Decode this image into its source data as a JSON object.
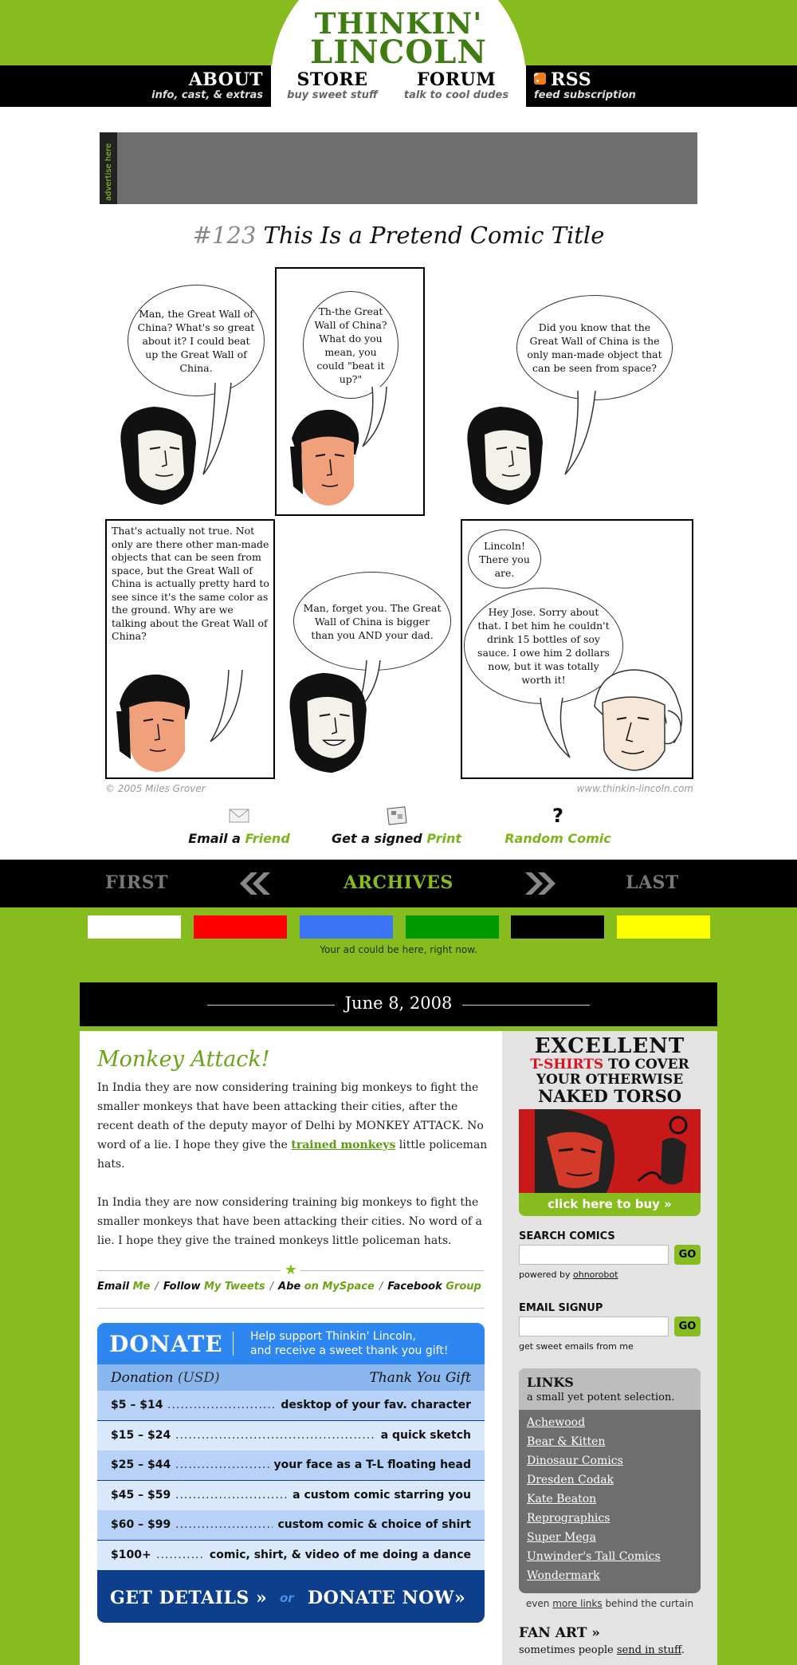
{
  "header": {
    "logo_line1": "THINKIN'",
    "logo_line2": "LINCOLN",
    "nav": [
      {
        "title": "ABOUT",
        "sub": "info, cast, & extras"
      },
      {
        "title": "STORE",
        "sub": "buy sweet stuff"
      },
      {
        "title": "FORUM",
        "sub": "talk to cool dudes"
      },
      {
        "title": "RSS",
        "sub": "feed subscription"
      }
    ]
  },
  "ad": {
    "side_label": "advertise here"
  },
  "comic": {
    "number": "#123",
    "title": "This Is a Pretend Comic Title",
    "bubbles": [
      "Man, the Great Wall of China? What's so great about it? I could beat up the Great Wall of China.",
      "Th-the Great Wall of China? What do you mean, you could \"beat it up?\"",
      "Did you know that the Great Wall of China is the only man-made object that can be seen from space?",
      "That's actually not true. Not only are there other man-made objects that can be seen from space, but the Great Wall of China is actually pretty hard to see since it's the same color as the ground. Why are we talking about the Great Wall of China?",
      "Man, forget you. The Great Wall of China is bigger than you AND your dad.",
      "Lincoln! There you are.",
      "Hey Jose. Sorry about that. I bet him he couldn't drink 15 bottles of soy sauce. I owe him 2 dollars now, but it was totally worth it!"
    ],
    "copyright": "© 2005 Miles Grover",
    "site": "www.thinkin-lincoln.com"
  },
  "share": {
    "email_a": "Email a",
    "email_b": "Friend",
    "print_a": "Get a signed",
    "print_b": "Print",
    "random": "Random Comic"
  },
  "comic_nav": {
    "first": "FIRST",
    "archives": "ARCHIVES",
    "last": "LAST"
  },
  "swatches": {
    "colors": [
      "#ffffff",
      "#ff0000",
      "#3b74f5",
      "#009900",
      "#000000",
      "#ffff00"
    ],
    "caption": "Your ad could be here, right now."
  },
  "post": {
    "date": "June 8, 2008",
    "title": "Monkey Attack!",
    "p1_a": "In India they are now considering training big monkeys to fight the smaller monkeys that have been attacking their cities, after the recent death of the deputy mayor of Delhi by MONKEY ATTACK. No word of a lie. I hope they give the",
    "p1_link": "trained monkeys",
    "p1_b": "little policeman hats.",
    "p2": "In India they are now considering training big monkeys to fight the smaller monkeys that have been attacking their cities. No word of a lie. I hope they give the trained monkeys little policeman hats.",
    "social": [
      {
        "a": "Email",
        "b": "Me"
      },
      {
        "a": "Follow",
        "b": "My Tweets"
      },
      {
        "a": "Abe",
        "b": "on MySpace"
      },
      {
        "a": "Facebook",
        "b": "Group"
      }
    ]
  },
  "donate": {
    "title": "DONATE",
    "sub1": "Help support Thinkin' Lincoln,",
    "sub2": "and receive a sweet thank you gift!",
    "col_left": "Donation",
    "col_left_unit": "(USD)",
    "col_right": "Thank You Gift",
    "rows": [
      {
        "amount": "$5 – $14",
        "gift": "desktop of your fav. character"
      },
      {
        "amount": "$15 – $24",
        "gift": "a quick sketch"
      },
      {
        "amount": "$25 – $44",
        "gift": "your face as a T-L floating head"
      },
      {
        "amount": "$45 – $59",
        "gift": "a custom comic starring you"
      },
      {
        "amount": "$60 – $99",
        "gift": "custom comic & choice of shirt"
      },
      {
        "amount": "$100+",
        "gift": "comic, shirt, & video of me doing a dance"
      }
    ],
    "details": "GET DETAILS »",
    "or": "or",
    "now": "DONATE NOW»"
  },
  "sidebar": {
    "tshirt_h1": "EXCELLENT",
    "tshirt_red": "T-SHIRTS",
    "tshirt_h2a": "TO COVER",
    "tshirt_h2b": "YOUR OTHERWISE",
    "tshirt_h2c": "NAKED TORSO",
    "tshirt_btn": "click here to buy »",
    "search_label": "SEARCH COMICS",
    "search_placeholder": "",
    "search_go": "GO",
    "powered": "powered by",
    "powered_link": "ohnorobot",
    "email_label": "EMAIL SIGNUP",
    "email_placeholder": "",
    "email_go": "GO",
    "email_note": "get sweet emails from me",
    "links_title": "LINKS",
    "links_sub": "a small yet potent selection.",
    "links": [
      "Achewood",
      "Bear & Kitten",
      "Dinosaur Comics",
      "Dresden Codak",
      "Kate Beaton",
      "Reprographics",
      "Super Mega",
      "Unwinder's Tall Comics",
      "Wondermark"
    ],
    "more_a": "even",
    "more_link": "more links",
    "more_b": "behind the curtain",
    "fanart_title": "FAN ART »",
    "fanart_a": "sometimes people",
    "fanart_link": "send in stuff",
    "fanart_b": "."
  },
  "colors": {
    "brand_green": "#86bc1e",
    "donate_blue": "#2e86f0",
    "donate_navy": "#0d3f8c",
    "tshirt_red": "#d8141d"
  }
}
